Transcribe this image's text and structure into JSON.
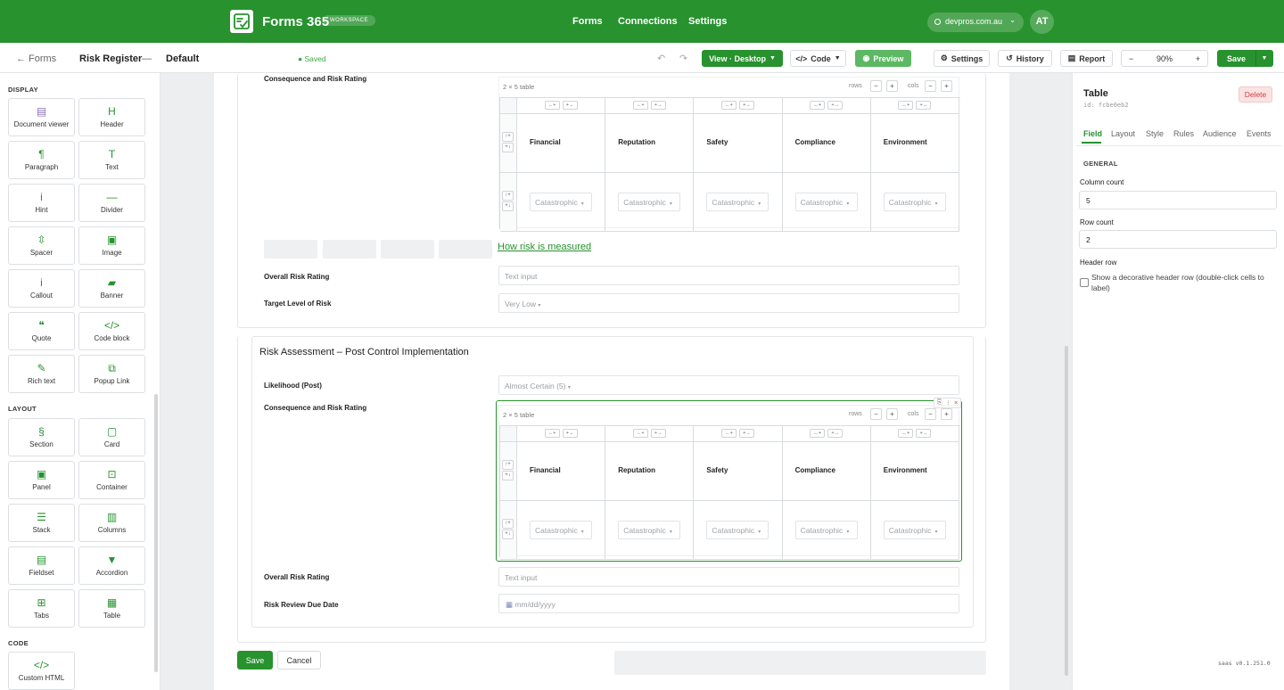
{
  "topbar": {
    "app_name": "Forms 365",
    "workspace_badge": "WORKSPACE",
    "nav": [
      "Forms",
      "Connections",
      "Settings"
    ],
    "domain": "devpros.com.au",
    "avatar_initials": "AT",
    "brand_color": "#27922e"
  },
  "toolbar": {
    "back_label": "Forms",
    "form_name": "Risk Register",
    "separator": "—",
    "variant": "Default",
    "saved_status": "Saved",
    "view_label": "View · Desktop",
    "code_label": "Code",
    "preview_label": "Preview",
    "settings_label": "Settings",
    "history_label": "History",
    "report_label": "Report",
    "zoom": "90%",
    "save_label": "Save"
  },
  "sidebar": {
    "display_title": "DISPLAY",
    "layout_title": "LAYOUT",
    "code_title": "CODE",
    "display_items": [
      {
        "label": "Document viewer",
        "icon": "document-icon"
      },
      {
        "label": "Header",
        "icon": "header-icon"
      },
      {
        "label": "Paragraph",
        "icon": "pilcrow-icon"
      },
      {
        "label": "Text",
        "icon": "text-icon"
      },
      {
        "label": "Hint",
        "icon": "info-icon"
      },
      {
        "label": "Divider",
        "icon": "divider-icon"
      },
      {
        "label": "Spacer",
        "icon": "spacer-icon"
      },
      {
        "label": "Image",
        "icon": "image-icon"
      },
      {
        "label": "Callout",
        "icon": "info-icon"
      },
      {
        "label": "Banner",
        "icon": "banner-icon"
      },
      {
        "label": "Quote",
        "icon": "quote-icon"
      },
      {
        "label": "Code block",
        "icon": "code-icon"
      },
      {
        "label": "Rich text",
        "icon": "pen-icon"
      },
      {
        "label": "Popup Link",
        "icon": "popup-icon"
      }
    ],
    "layout_items": [
      {
        "label": "Section",
        "icon": "section-icon"
      },
      {
        "label": "Card",
        "icon": "card-icon"
      },
      {
        "label": "Panel",
        "icon": "panel-icon"
      },
      {
        "label": "Container",
        "icon": "container-icon"
      },
      {
        "label": "Stack",
        "icon": "stack-icon"
      },
      {
        "label": "Columns",
        "icon": "columns-icon"
      },
      {
        "label": "Fieldset",
        "icon": "fieldset-icon"
      },
      {
        "label": "Accordion",
        "icon": "accordion-icon"
      },
      {
        "label": "Tabs",
        "icon": "tabs-icon"
      },
      {
        "label": "Table",
        "icon": "table-icon"
      }
    ],
    "code_items": [
      {
        "label": "Custom HTML",
        "icon": "code-icon"
      }
    ]
  },
  "canvas": {
    "pre": {
      "consequence_label": "Consequence and Risk Rating",
      "table_title": "2 × 5 table",
      "rows_label": "rows",
      "cols_label": "cols",
      "columns": [
        "Financial",
        "Reputation",
        "Safety",
        "Compliance",
        "Environment"
      ],
      "cell_value": "Catastrophic",
      "link_text": "How risk is measured",
      "overall_label": "Overall Risk Rating",
      "overall_placeholder": "Text input",
      "target_label": "Target Level of Risk",
      "target_value": "Very Low"
    },
    "post": {
      "section_title": "Risk Assessment – Post Control Implementation",
      "likelihood_label": "Likelihood (Post)",
      "likelihood_value": "Almost Certain (5)",
      "consequence_label": "Consequence and Risk Rating",
      "table_title": "2 × 5 table",
      "rows_label": "rows",
      "cols_label": "cols",
      "columns": [
        "Financial",
        "Reputation",
        "Safety",
        "Compliance",
        "Environment"
      ],
      "cell_value": "Catastrophic",
      "overall_label": "Overall Risk Rating",
      "overall_placeholder": "Text input",
      "review_label": "Risk Review Due Date",
      "review_placeholder": "mm/dd/yyyy"
    },
    "save_label": "Save",
    "cancel_label": "Cancel"
  },
  "inspector": {
    "title": "Table",
    "id_text": "id: fcbe0eb2",
    "delete_label": "Delete",
    "tabs": [
      "Field",
      "Layout",
      "Style",
      "Rules",
      "Audience",
      "Events"
    ],
    "active_tab": "Field",
    "general_title": "GENERAL",
    "column_count_label": "Column count",
    "column_count": "5",
    "row_count_label": "Row count",
    "row_count": "2",
    "header_row_label": "Header row",
    "header_row_checkbox_label": "Show a decorative header row (double-click cells to label)",
    "header_row_checked": false
  },
  "version": "saas v0.1.251.0"
}
